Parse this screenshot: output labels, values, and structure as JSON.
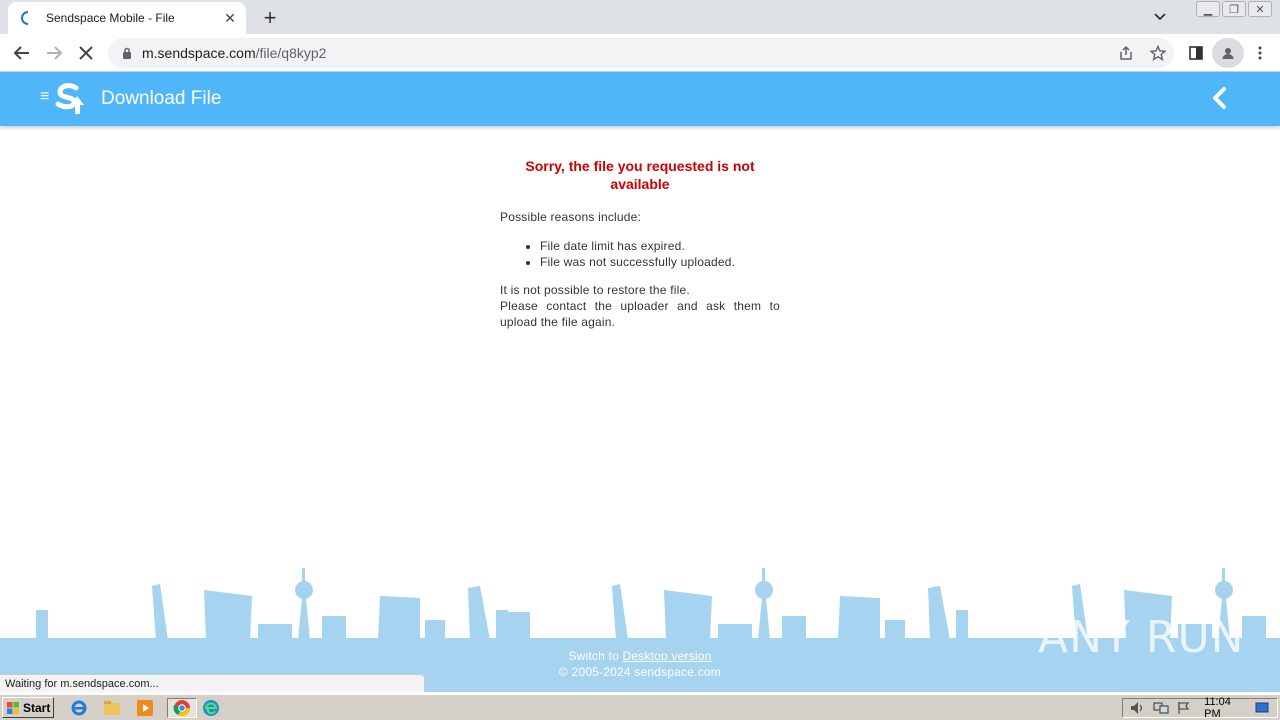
{
  "browser": {
    "tab_title": "Sendspace Mobile - File",
    "url_host": "m.sendspace.com",
    "url_path": "/file/q8kyp2",
    "status_text": "Waiting for m.sendspace.com..."
  },
  "header": {
    "title": "Download File"
  },
  "error": {
    "title": "Sorry, the file you requested is not available",
    "reasons_intro": "Possible reasons include:",
    "reasons": [
      "File date limit has expired.",
      "File was not successfully uploaded."
    ],
    "restore_line1": "It is not possible to restore the file.",
    "restore_line2": "Please contact the uploader and ask them to upload the file again."
  },
  "footer": {
    "switch_prefix": "Switch to",
    "switch_link": "Desktop version",
    "copyright": "© 2005-2024 sendspace.com"
  },
  "watermark": "ANY RUN",
  "taskbar": {
    "start_label": "Start",
    "clock": "11:04 PM"
  },
  "colors": {
    "header_bg": "#4fb6f9",
    "error_red": "#cc0000",
    "skyline": "#a6d3ef"
  }
}
